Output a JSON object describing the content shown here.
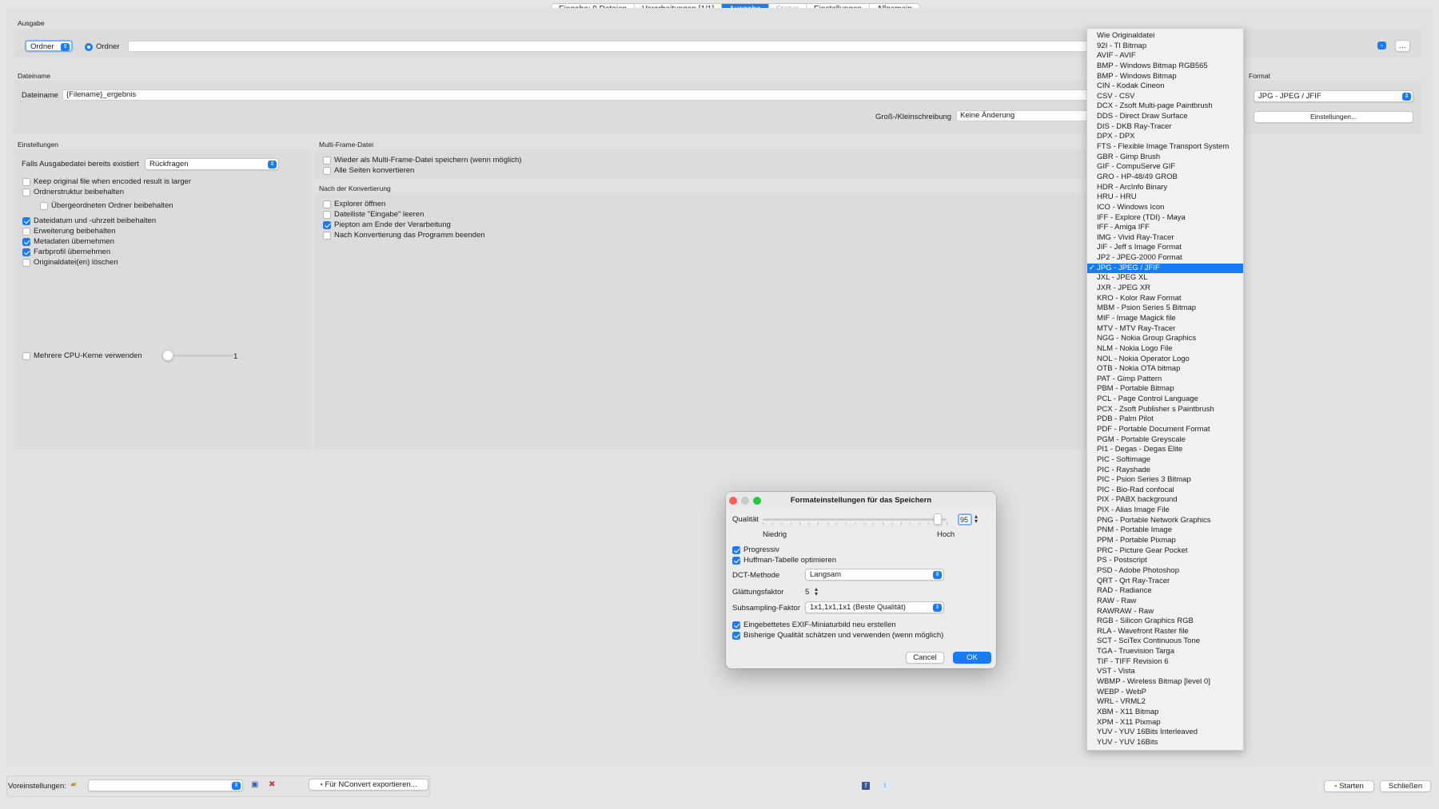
{
  "tabs": [
    {
      "label": "Eingabe: 9 Dateien",
      "state": "normal"
    },
    {
      "label": "Verarbeitungen [1/1]",
      "state": "normal"
    },
    {
      "label": "Ausgabe",
      "state": "active"
    },
    {
      "label": "Status",
      "state": "disabled"
    },
    {
      "label": "Einstellungen",
      "state": "normal"
    },
    {
      "label": "Allgemein",
      "state": "normal"
    }
  ],
  "output": {
    "section_label": "Ausgabe",
    "mode_select": "Ordner",
    "radio_label": "Ordner",
    "path_value": "",
    "browse_label": "..."
  },
  "filename": {
    "section_label": "Dateiname",
    "label": "Dateiname",
    "value": "{Filename}_ergebnis",
    "case_label": "Groß-/Kleinschreibung",
    "case_value": "Keine Änderung"
  },
  "format": {
    "section_label": "Format",
    "selected": "JPG - JPEG / JFIF",
    "settings_button": "Einstellungen..."
  },
  "settings": {
    "section_label": "Einstellungen",
    "exists_label": "Falls Ausgabedatei bereits existiert",
    "exists_value": "Rückfragen",
    "checkboxes": [
      {
        "label": "Keep original file when encoded result is larger",
        "checked": false
      },
      {
        "label": "Ordnerstruktur beibehalten",
        "checked": false
      },
      {
        "label": "Übergeordneten Ordner beibehalten",
        "checked": false
      },
      {
        "label": "Dateidatum und -uhrzeit beibehalten",
        "checked": true
      },
      {
        "label": "Erweiterung beibehalten",
        "checked": false
      },
      {
        "label": "Metadaten übernehmen",
        "checked": true
      },
      {
        "label": "Farbprofil übernehmen",
        "checked": true
      },
      {
        "label": "Originaldatei(en) löschen",
        "checked": false
      }
    ],
    "cpu_label": "Mehrere CPU-Kerne verwenden",
    "cpu_checked": false,
    "cpu_value": "1"
  },
  "multiframe": {
    "section_label": "Multi-Frame-Datei",
    "checkboxes": [
      {
        "label": "Wieder als Multi-Frame-Datei speichern (wenn möglich)",
        "checked": false
      },
      {
        "label": "Alle Seiten konvertieren",
        "checked": false
      }
    ]
  },
  "after": {
    "section_label": "Nach der Konvertierung",
    "checkboxes": [
      {
        "label": "Explorer öffnen",
        "checked": false
      },
      {
        "label": "Dateiliste \"Eingabe\" leeren",
        "checked": false
      },
      {
        "label": "Piepton am Ende der Verarbeitung",
        "checked": true
      },
      {
        "label": "Nach Konvertierung das Programm beenden",
        "checked": false
      }
    ]
  },
  "format_list": [
    "Wie Originaldatei",
    "92I - TI Bitmap",
    "AVIF - AVIF",
    "BMP - Windows Bitmap RGB565",
    "BMP - Windows Bitmap",
    "CIN - Kodak Cineon",
    "CSV - CSV",
    "DCX - Zsoft Multi-page Paintbrush",
    "DDS - Direct Draw Surface",
    "DIS - DKB Ray-Tracer",
    "DPX - DPX",
    "FTS - Flexible Image Transport System",
    "GBR - Gimp Brush",
    "GIF - CompuServe GIF",
    "GRO - HP-48/49 GROB",
    "HDR - ArcInfo Binary",
    "HRU - HRU",
    "ICO - Windows Icon",
    "IFF - Explore (TDI) - Maya",
    "IFF - Amiga IFF",
    "IMG - Vivid Ray-Tracer",
    "JIF - Jeff s Image Format",
    "JP2 - JPEG-2000 Format",
    "JPG - JPEG / JFIF",
    "JXL - JPEG XL",
    "JXR - JPEG XR",
    "KRO - Kolor Raw Format",
    "MBM - Psion Series 5 Bitmap",
    "MIF - Image Magick file",
    "MTV - MTV Ray-Tracer",
    "NGG - Nokia Group Graphics",
    "NLM - Nokia Logo File",
    "NOL - Nokia Operator Logo",
    "OTB - Nokia OTA bitmap",
    "PAT - Gimp Pattern",
    "PBM - Portable Bitmap",
    "PCL - Page Control Language",
    "PCX - Zsoft Publisher s Paintbrush",
    "PDB - Palm Pilot",
    "PDF - Portable Document Format",
    "PGM - Portable Greyscale",
    "PI1 - Degas - Degas Elite",
    "PIC - Softimage",
    "PIC - Rayshade",
    "PIC - Psion Series 3 Bitmap",
    "PIC - Bio-Rad confocal",
    "PIX - PABX background",
    "PIX - Alias Image File",
    "PNG - Portable Network Graphics",
    "PNM - Portable Image",
    "PPM - Portable Pixmap",
    "PRC - Picture Gear Pocket",
    "PS - Postscript",
    "PSD - Adobe Photoshop",
    "QRT - Qrt Ray-Tracer",
    "RAD - Radiance",
    "RAW - Raw",
    "RAWRAW - Raw",
    "RGB - Silicon Graphics RGB",
    "RLA - Wavefront Raster file",
    "SCT - SciTex Continuous Tone",
    "TGA - Truevision Targa",
    "TIF - TIFF Revision 6",
    "VST - Vista",
    "WBMP - Wireless Bitmap [level 0]",
    "WEBP - WebP",
    "WRL - VRML2",
    "XBM - X11 Bitmap",
    "XPM - X11 Pixmap",
    "YUV - YUV 16Bits Interleaved",
    "YUV - YUV 16Bits"
  ],
  "format_list_selected_index": 23,
  "dialog": {
    "title": "Formateinstellungen für das Speichern",
    "quality_label": "Qualität",
    "quality_value": "95",
    "quality_level": 0.95,
    "low_label": "Niedrig",
    "high_label": "Hoch",
    "progressive_label": "Progressiv",
    "progressive_checked": true,
    "huffman_label": "Huffman-Tabelle optimieren",
    "huffman_checked": true,
    "dct_label": "DCT-Methode",
    "dct_value": "Langsam",
    "smoothing_label": "Glättungsfaktor",
    "smoothing_value": "5",
    "subsampling_label": "Subsampling-Faktor",
    "subsampling_value": "1x1,1x1,1x1 (Beste Qualität)",
    "exif_label": "Eingebettetes EXIF-Miniaturbild neu erstellen",
    "exif_checked": true,
    "estimate_label": "Bisherige Qualität schätzen und verwenden (wenn möglich)",
    "estimate_checked": true,
    "cancel_label": "Cancel",
    "ok_label": "OK"
  },
  "footer": {
    "presets_label": "Voreinstellungen:",
    "presets_value": "",
    "export_label": "Für NConvert exportieren...",
    "start_label": "Starten",
    "close_label": "Schließen"
  },
  "colors": {
    "accent": "#1a7cf5",
    "background": "#e6e6e6",
    "panel": "#dcdcdc"
  }
}
